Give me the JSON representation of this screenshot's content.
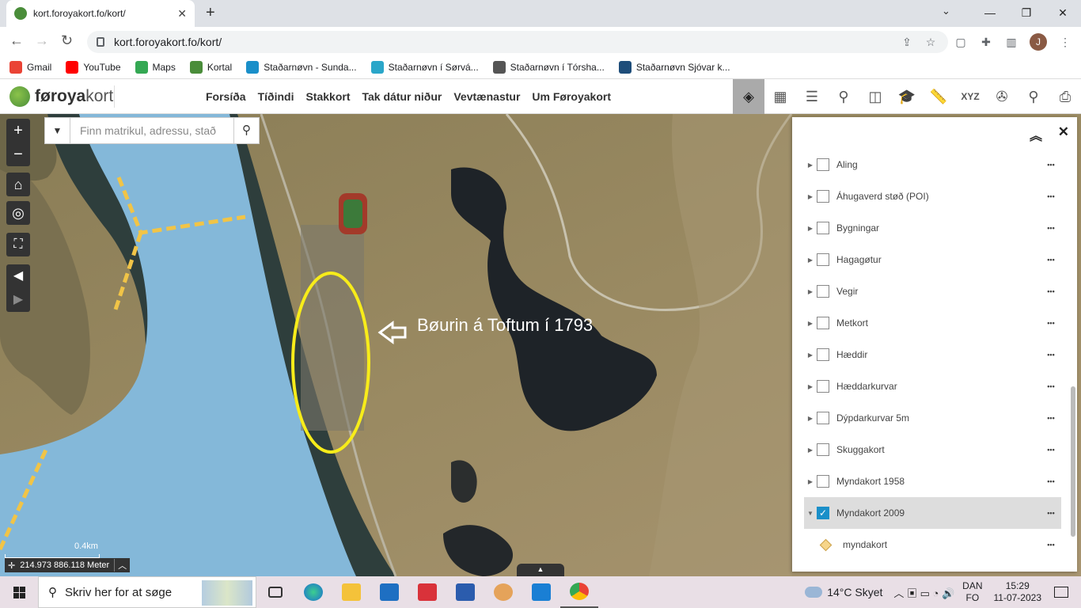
{
  "browser": {
    "tab_title": "kort.foroyakort.fo/kort/",
    "url": "kort.foroyakort.fo/kort/"
  },
  "bookmarks": [
    {
      "label": "Gmail",
      "color": "#ea4335"
    },
    {
      "label": "YouTube",
      "color": "#ff0000"
    },
    {
      "label": "Maps",
      "color": "#34a853"
    },
    {
      "label": "Kortal",
      "color": "#4a8d3a"
    },
    {
      "label": "Staðarnøvn - Sunda...",
      "color": "#1a8fc9"
    },
    {
      "label": "Staðarnøvn í Sørvá...",
      "color": "#2aa6c9"
    },
    {
      "label": "Staðarnøvn í Tórsha...",
      "color": "#555555"
    },
    {
      "label": "Staðarnøvn Sjóvar k...",
      "color": "#1e4d7a"
    }
  ],
  "app": {
    "logo_a": "føroya",
    "logo_b": "kort",
    "nav": [
      "Forsíða",
      "Tíðindi",
      "Stakkort",
      "Tak dátur niður",
      "Vevtænastur",
      "Um Føroyakort"
    ],
    "tools": [
      "layers-icon",
      "grid-icon",
      "list-icon",
      "search-map-icon",
      "compare-icon",
      "education-icon",
      "ruler-icon",
      "xyz-icon",
      "film-icon",
      "pin-icon",
      "print-icon"
    ],
    "tools_xyz_label": "XYZ"
  },
  "map": {
    "search_placeholder": "Finn matrikul, adressu, stað",
    "annotation": "Bøurin á Toftum í 1793",
    "scale_label": "0.4km",
    "coordinate_readout": "214.973 886.118 Meter"
  },
  "layers": [
    {
      "label": "Aling",
      "checked": false
    },
    {
      "label": "Áhugaverd støð (POI)",
      "checked": false
    },
    {
      "label": "Bygningar",
      "checked": false
    },
    {
      "label": "Hagagøtur",
      "checked": false
    },
    {
      "label": "Vegir",
      "checked": false
    },
    {
      "label": "Metkort",
      "checked": false
    },
    {
      "label": "Hæddir",
      "checked": false
    },
    {
      "label": "Hæddarkurvar",
      "checked": false
    },
    {
      "label": "Dýpdarkurvar 5m",
      "checked": false
    },
    {
      "label": "Skuggakort",
      "checked": false
    },
    {
      "label": "Myndakort 1958",
      "checked": false
    },
    {
      "label": "Myndakort 2009",
      "checked": true
    }
  ],
  "sublayer": {
    "label": "myndakort"
  },
  "taskbar": {
    "search_text": "Skriv her for at søge",
    "weather": "14°C  Skyet",
    "lang_1": "DAN",
    "lang_2": "FO",
    "time": "15:29",
    "date": "11-07-2023"
  }
}
